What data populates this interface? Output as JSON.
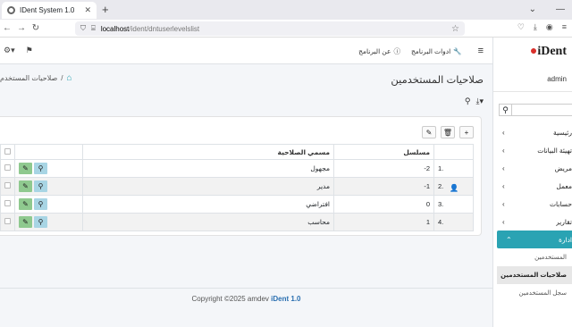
{
  "browser": {
    "tab_title": "IDent System 1.0",
    "url_host": "localhost",
    "url_path": "/ident/dntuserlevelslist"
  },
  "icons": [
    "close-icon",
    "plus-icon",
    "back-arrow-icon",
    "reload-icon",
    "shield-icon",
    "page-info-icon",
    "star-icon",
    "pocket-icon",
    "download-icon",
    "profile-icon",
    "menu-icon",
    "wrench-icon",
    "info-icon",
    "gear-icon",
    "flag-icon",
    "home-icon",
    "search-icon",
    "export-icon",
    "add-icon",
    "delete-icon",
    "edit-icon",
    "view-icon",
    "user-icon",
    "chevron-icon"
  ],
  "topbar": {
    "tools_label": "ادوات البرنامج",
    "about_label": "عن البرنامج"
  },
  "sidebar": {
    "logo_text": "iDent",
    "user": "admin",
    "menu": [
      {
        "label": "رئيسية"
      },
      {
        "label": "تهيئة البيانات"
      },
      {
        "label": "مريض"
      },
      {
        "label": "معمل"
      },
      {
        "label": "حسابات"
      },
      {
        "label": "تقارير"
      },
      {
        "label": "ادارة"
      }
    ],
    "sub": [
      {
        "label": "المستخدمين"
      },
      {
        "label": "صلاحيات المستخدمين"
      },
      {
        "label": "سجل المستخدمين"
      }
    ]
  },
  "page": {
    "title": "صلاحيات المستخدمين",
    "breadcrumb": "صلاحيات المستخدم"
  },
  "table": {
    "headers": {
      "serial": "مسلسل",
      "name": "مسمي الصلاحية"
    },
    "rows": [
      {
        "index": "1.",
        "serial": "-2",
        "name": "مجهول"
      },
      {
        "index": "2.",
        "serial": "-1",
        "name": "مدير"
      },
      {
        "index": "3.",
        "serial": "0",
        "name": "افتراضي"
      },
      {
        "index": "4.",
        "serial": "1",
        "name": "محاسب"
      }
    ]
  },
  "footer": {
    "copyright": "Copyright ©2025 amdev",
    "brand": "iDent 1.0"
  }
}
